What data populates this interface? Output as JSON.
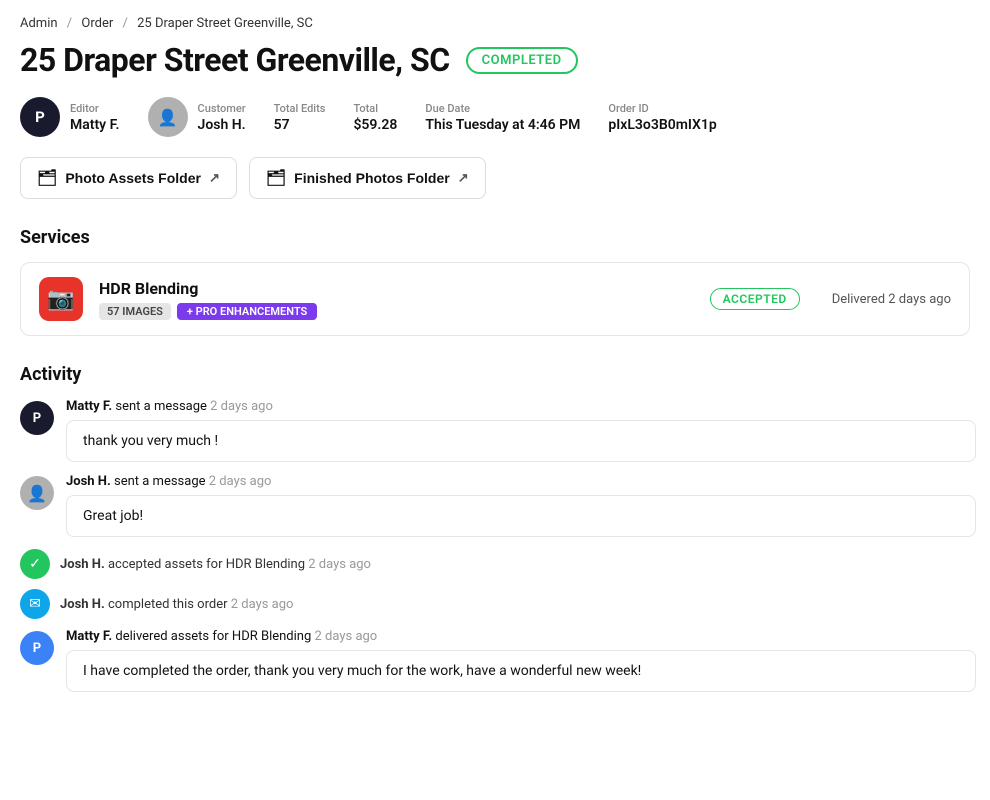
{
  "breadcrumb": {
    "items": [
      "Admin",
      "Order",
      "25 Draper Street  Greenville, SC"
    ]
  },
  "header": {
    "title": "25 Draper Street  Greenville, SC",
    "status": "COMPLETED"
  },
  "meta": {
    "editor_label": "Editor",
    "editor_name": "Matty F.",
    "editor_initials": "P",
    "customer_label": "Customer",
    "customer_name": "Josh H.",
    "total_edits_label": "Total Edits",
    "total_edits_value": "57",
    "total_label": "Total",
    "total_value": "$59.28",
    "due_date_label": "Due Date",
    "due_date_value": "This Tuesday at 4:46 PM",
    "order_id_label": "Order ID",
    "order_id_value": "pIxL3o3B0mIX1p"
  },
  "folders": {
    "photo_assets_label": "Photo Assets Folder",
    "finished_photos_label": "Finished Photos Folder"
  },
  "services": {
    "section_title": "Services",
    "items": [
      {
        "name": "HDR Blending",
        "images_tag": "57 IMAGES",
        "pro_tag": "+ PRO ENHANCEMENTS",
        "status_badge": "ACCEPTED",
        "delivered_text": "Delivered 2 days ago"
      }
    ]
  },
  "activity": {
    "section_title": "Activity",
    "items": [
      {
        "type": "message",
        "sender": "Matty F.",
        "action": " sent a message",
        "time": "2 days ago",
        "message": "thank you very much !",
        "avatar_type": "editor",
        "initials": "P"
      },
      {
        "type": "message",
        "sender": "Josh H.",
        "action": "sent a message",
        "time": "2 days ago",
        "message": "Great job!",
        "avatar_type": "customer",
        "initials": "👤"
      },
      {
        "type": "event",
        "text_bold": "Josh H.",
        "text_action": " accepted assets for HDR Blending",
        "time": "2 days ago",
        "icon_type": "green",
        "icon_symbol": "✓"
      },
      {
        "type": "event",
        "text_bold": "Josh H.",
        "text_action": "completed this order",
        "time": "2 days ago",
        "icon_type": "teal",
        "icon_symbol": "✉"
      },
      {
        "type": "message",
        "sender": "Matty F.",
        "action": "delivered assets for HDR Blending",
        "time": "2 days ago",
        "message": "I have completed the order, thank you very much for the work, have a wonderful new week!",
        "avatar_type": "blue",
        "initials": "P"
      }
    ]
  }
}
